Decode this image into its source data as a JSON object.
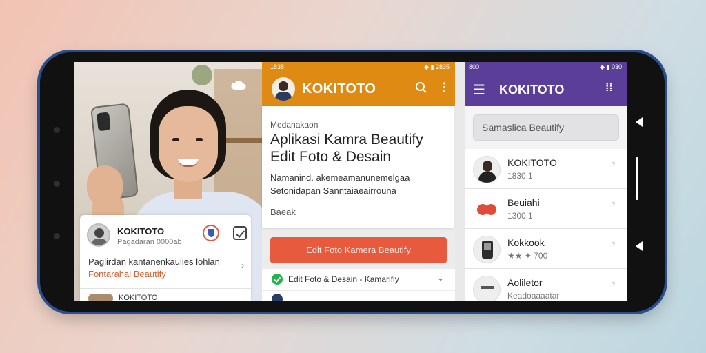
{
  "panel1": {
    "card": {
      "name": "KOKITOTO",
      "subtitle": "Pagadaran 0000ab",
      "line1": "Paglirdan kantanenkaulies lohlan",
      "line2": "Fontarahal Beautify",
      "next_label": "KOKITOTO"
    }
  },
  "panel2": {
    "status_time": "1838",
    "status_right": "◆ ▮ 2835",
    "appbar_title": "KOKITOTO",
    "card": {
      "small": "Medanakaon",
      "heading": "Aplikasi Kamra Beautify Edit Foto & Desain",
      "desc": "Namanind. akemeamanunemelgaa Setonidapan Sanntaiaeairrouna",
      "foot": "Baeak"
    },
    "button_label": "Edit Foto Kamera Beautify",
    "row_label": "Edit Foto & Desain - Kamarifiy"
  },
  "panel3": {
    "status_time": "800",
    "status_right": "◆ ▮ 030",
    "appbar_title": "KOKITOTO",
    "search_placeholder": "Samaslica Beautify",
    "items": [
      {
        "name": "KOKITOTO",
        "sub": "1830.1",
        "icon": "person-icon"
      },
      {
        "name": "Beuiahi",
        "sub": "1300.1",
        "icon": "heart-icon"
      },
      {
        "name": "Kokkook",
        "sub": "★★ ✦ 700",
        "icon": "phone-icon"
      },
      {
        "name": "Aoliletor",
        "sub": "Keadoaaaatar",
        "icon": "app-icon"
      }
    ]
  }
}
